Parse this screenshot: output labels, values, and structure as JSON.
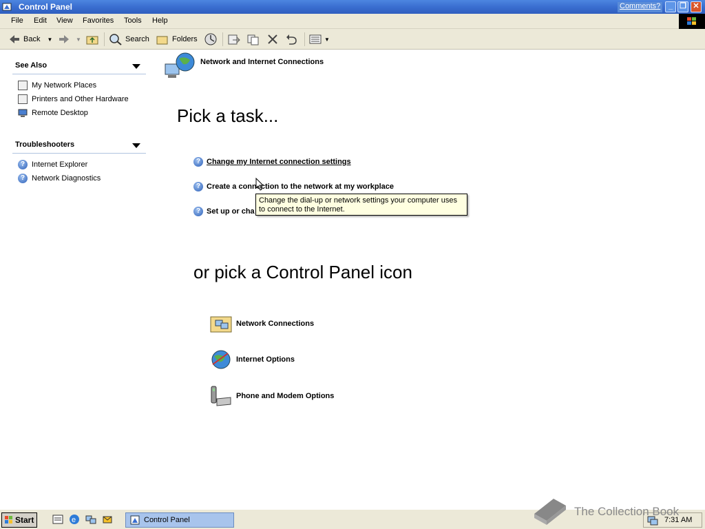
{
  "window": {
    "title": "Control Panel",
    "comments": "Comments?"
  },
  "menu": [
    "File",
    "Edit",
    "View",
    "Favorites",
    "Tools",
    "Help"
  ],
  "toolbar": {
    "back": "Back",
    "search": "Search",
    "folders": "Folders"
  },
  "left": {
    "see_also": {
      "title": "See Also",
      "items": [
        "My Network Places",
        "Printers and Other Hardware",
        "Remote Desktop"
      ]
    },
    "troubleshooters": {
      "title": "Troubleshooters",
      "items": [
        "Internet Explorer",
        "Network Diagnostics"
      ]
    }
  },
  "main": {
    "heading": "Network and Internet Connections",
    "pick_task": "Pick a task...",
    "tasks": [
      "Change my Internet connection settings",
      "Create a connection to the network at my workplace",
      "Set up or cha"
    ],
    "pick_icon": "or pick a Control Panel icon",
    "icons": [
      "Network Connections",
      "Internet Options",
      "Phone and Modem Options"
    ]
  },
  "tooltip": "Change the dial-up or network settings your computer uses to connect to the Internet.",
  "taskbar": {
    "start": "Start",
    "task": "Control Panel",
    "clock": "7:31 AM"
  },
  "watermark": "The Collection Book",
  "colors": {
    "titlebar": "#3a6ed0",
    "chrome": "#ece9d8",
    "tooltip": "#ffffe1",
    "link_blue": "#2c5fb8"
  }
}
